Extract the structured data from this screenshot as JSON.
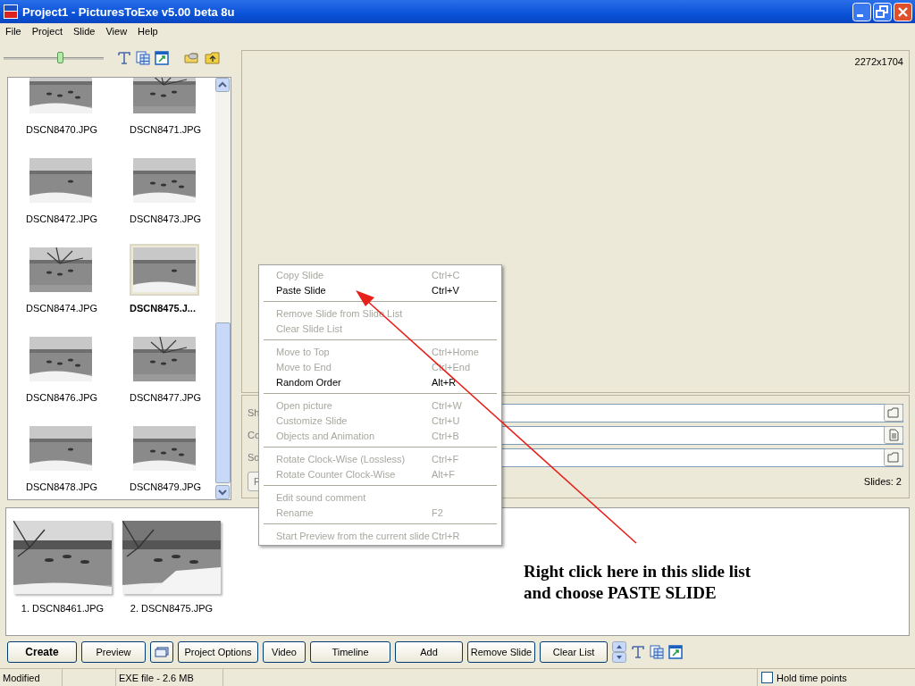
{
  "window": {
    "title": "Project1 - PicturesToExe v5.00 beta 8u"
  },
  "menu": [
    "File",
    "Project",
    "Slide",
    "View",
    "Help"
  ],
  "zoom_slider": {
    "level": 0.56
  },
  "file_list": [
    {
      "name": "DSCN8470.JPG",
      "selected": false
    },
    {
      "name": "DSCN8471.JPG",
      "selected": false
    },
    {
      "name": "DSCN8472.JPG",
      "selected": false
    },
    {
      "name": "DSCN8473.JPG",
      "selected": false
    },
    {
      "name": "DSCN8474.JPG",
      "selected": false
    },
    {
      "name": "DSCN8475.J...",
      "selected": true
    },
    {
      "name": "DSCN8476.JPG",
      "selected": false
    },
    {
      "name": "DSCN8477.JPG",
      "selected": false
    },
    {
      "name": "DSCN8478.JPG",
      "selected": false
    },
    {
      "name": "DSCN8479.JPG",
      "selected": false
    }
  ],
  "preview": {
    "resolution": "2272x1704"
  },
  "fields": [
    {
      "label": "Sh"
    },
    {
      "label": "Co"
    },
    {
      "label": "So"
    }
  ],
  "fields_button": "F",
  "slides_count": "Slides: 2",
  "context_menu": [
    {
      "kind": "item",
      "label": "Copy Slide",
      "shortcut": "Ctrl+C",
      "disabled": true
    },
    {
      "kind": "item",
      "label": "Paste Slide",
      "shortcut": "Ctrl+V",
      "disabled": false
    },
    {
      "kind": "separator"
    },
    {
      "kind": "item",
      "label": "Remove Slide from Slide List",
      "disabled": true
    },
    {
      "kind": "item",
      "label": "Clear Slide List",
      "disabled": true
    },
    {
      "kind": "separator"
    },
    {
      "kind": "item",
      "label": "Move to Top",
      "shortcut": "Ctrl+Home",
      "disabled": true
    },
    {
      "kind": "item",
      "label": "Move to End",
      "shortcut": "Ctrl+End",
      "disabled": true
    },
    {
      "kind": "item",
      "label": "Random Order",
      "shortcut": "Alt+R",
      "disabled": false
    },
    {
      "kind": "separator"
    },
    {
      "kind": "item",
      "label": "Open picture",
      "shortcut": "Ctrl+W",
      "disabled": true
    },
    {
      "kind": "item",
      "label": "Customize Slide",
      "shortcut": "Ctrl+U",
      "disabled": true
    },
    {
      "kind": "item",
      "label": "Objects and Animation",
      "shortcut": "Ctrl+B",
      "disabled": true
    },
    {
      "kind": "separator"
    },
    {
      "kind": "item",
      "label": "Rotate Clock-Wise (Lossless)",
      "shortcut": "Ctrl+F",
      "disabled": true
    },
    {
      "kind": "item",
      "label": "Rotate Counter Clock-Wise",
      "shortcut": "Alt+F",
      "disabled": true
    },
    {
      "kind": "separator"
    },
    {
      "kind": "item",
      "label": "Edit sound comment",
      "disabled": true
    },
    {
      "kind": "item",
      "label": "Rename",
      "shortcut": "F2",
      "disabled": true
    },
    {
      "kind": "separator"
    },
    {
      "kind": "item",
      "label": "Start Preview from the current slide",
      "shortcut": "Ctrl+R",
      "disabled": true
    }
  ],
  "slide_list": [
    {
      "caption": "1. DSCN8461.JPG"
    },
    {
      "caption": "2. DSCN8475.JPG"
    }
  ],
  "annotation": [
    "Right click here in this slide list",
    "and choose PASTE SLIDE"
  ],
  "buttons": [
    {
      "kind": "text",
      "label": "Create",
      "default": true
    },
    {
      "kind": "text",
      "label": "Preview",
      "default": false
    },
    {
      "kind": "icon"
    },
    {
      "kind": "text",
      "label": "Project Options",
      "default": false
    },
    {
      "kind": "text",
      "label": "Video",
      "default": false
    },
    {
      "kind": "text",
      "label": "Timeline",
      "default": false
    },
    {
      "kind": "text",
      "label": "Add",
      "default": false
    },
    {
      "kind": "text",
      "label": "Remove Slide",
      "default": false
    },
    {
      "kind": "text",
      "label": "Clear List",
      "default": false
    }
  ],
  "status_bar": {
    "panels": [
      "Modified",
      "EXE file - 2.6 MB"
    ],
    "hold_time_points": {
      "label": "Hold time points",
      "checked": false
    }
  }
}
